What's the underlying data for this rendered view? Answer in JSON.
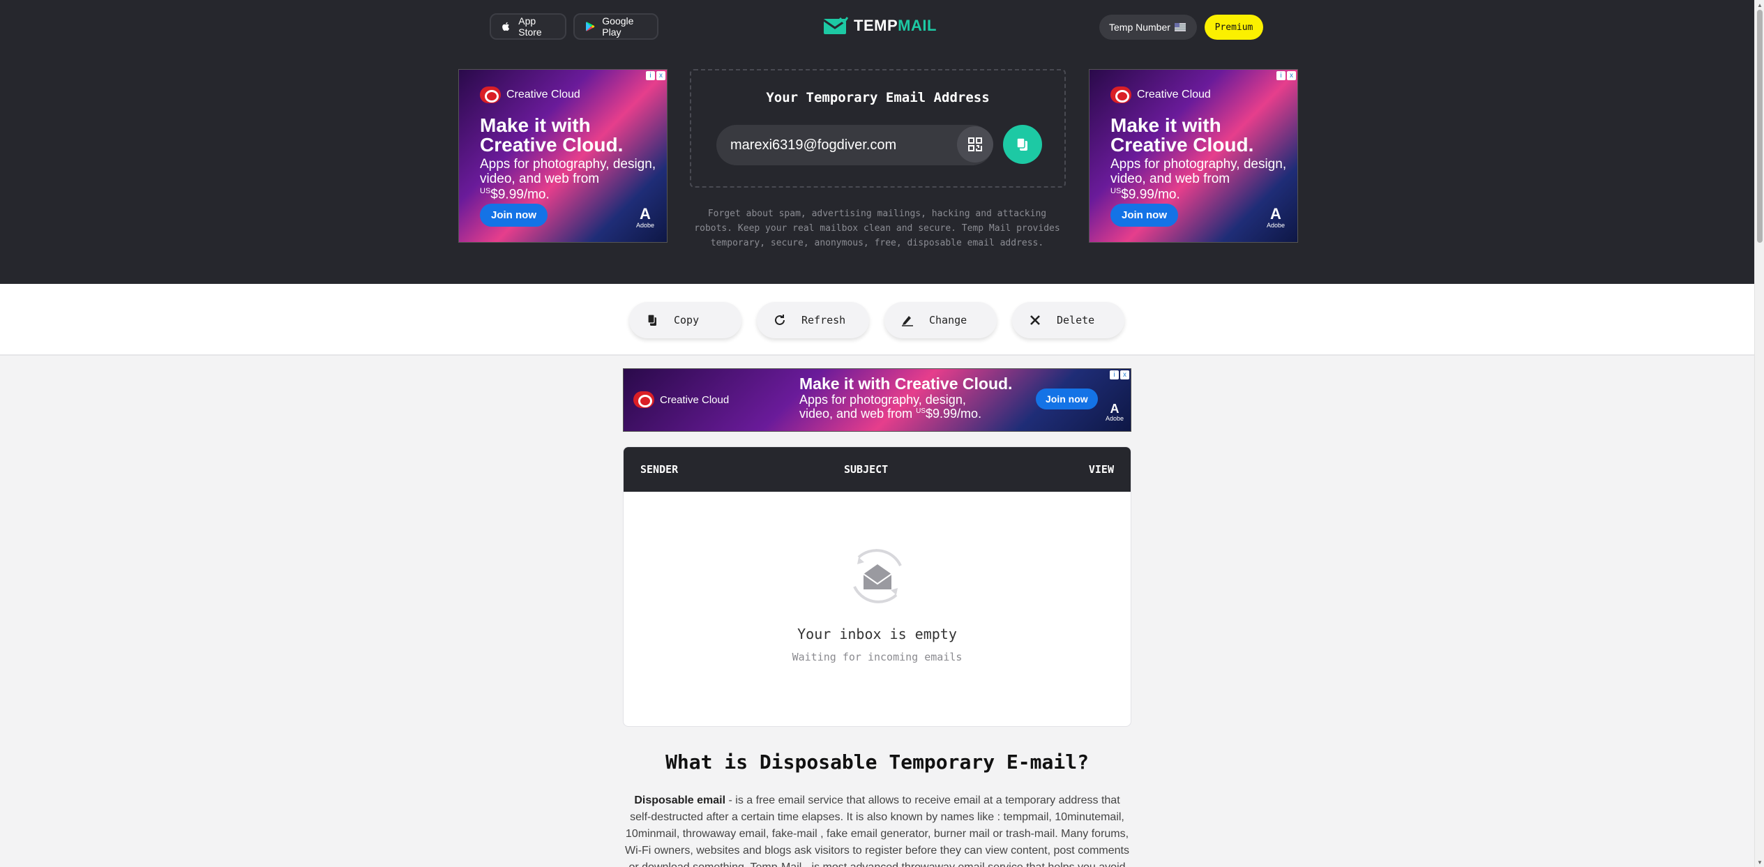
{
  "header": {
    "app_store": "App Store",
    "google_play": "Google Play",
    "logo_prefix": "TEMP",
    "logo_suffix": "MAIL",
    "temp_number": "Temp Number",
    "premium": "Premium"
  },
  "ads": {
    "side": {
      "brand": "Creative Cloud",
      "headline_1": "Make it with",
      "headline_2": "Creative Cloud.",
      "body_1": "Apps for photography, design,",
      "body_2": "video, and web from",
      "price_prefix": "US",
      "price": "$9.99/mo.",
      "cta": "Join now",
      "adobe": "Adobe"
    },
    "banner": {
      "brand": "Creative Cloud",
      "headline": "Make it with Creative Cloud.",
      "body_1": "Apps for photography, design,",
      "body_2": "video, and web from",
      "price_prefix": "US",
      "price": "$9.99/mo.",
      "cta": "Join now",
      "adobe": "Adobe"
    }
  },
  "email": {
    "title": "Your Temporary Email Address",
    "address": "marexi6319@fogdiver.com",
    "description": "Forget about spam, advertising mailings, hacking and attacking robots. Keep your real mailbox clean and secure. Temp Mail provides temporary, secure, anonymous, free, disposable email address."
  },
  "actions": {
    "copy": "Copy",
    "refresh": "Refresh",
    "change": "Change",
    "delete": "Delete"
  },
  "inbox": {
    "col_sender": "SENDER",
    "col_subject": "SUBJECT",
    "col_view": "VIEW",
    "empty_title": "Your inbox is empty",
    "empty_subtitle": "Waiting for incoming emails"
  },
  "article": {
    "title": "What is Disposable Temporary E-mail?",
    "lead": "Disposable email",
    "body": " - is a free email service that allows to receive email at a temporary address that self-destructed after a certain time elapses. It is also known by names like : tempmail, 10minutemail, 10minmail, throwaway email, fake-mail , fake email generator, burner mail or trash-mail. Many forums, Wi-Fi owners, websites and blogs ask visitors to register before they can view content, post comments or download something. Temp-Mail - is most advanced throwaway email service that helps you avoid"
  },
  "colors": {
    "header_bg": "#26272d",
    "accent": "#1dc9a4",
    "premium": "#fbf000"
  }
}
